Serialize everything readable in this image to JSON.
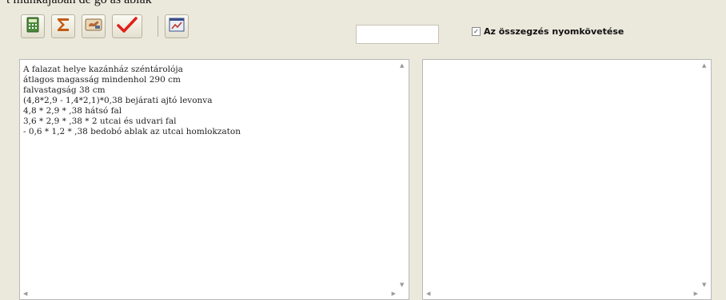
{
  "top_text": "t munkájában de gó ás ablak",
  "toolbar": {
    "buttons": [
      {
        "icon": "calculator-icon"
      },
      {
        "icon": "sigma-sum-icon"
      },
      {
        "icon": "hand-pointer-icon"
      },
      {
        "icon": "checkmark-icon"
      },
      {
        "icon": "chart-window-icon"
      }
    ]
  },
  "trace_option": {
    "label": "Az összegzés nyomkövetése",
    "checked": true,
    "check_glyph": "✓"
  },
  "calculation_lines": [
    "A falazat helye kazánház széntárolója",
    "átlagos magasság mindenhol 290 cm",
    "falvastagság 38 cm",
    "(4,8*2,9 - 1,4*2,1)*0,38 bejárati ajtó levonva",
    "4,8 * 2,9 * ,38 hátsó fal",
    "3,6 * 2,9 * ,38 * 2 utcai és udvari fal",
    "- 0,6 * 1,2 * ,38 bedobó ablak az utcai homlokzaton"
  ],
  "scroll_arrows": {
    "up": "▲",
    "down": "▼",
    "left": "◀",
    "right": "▶"
  }
}
